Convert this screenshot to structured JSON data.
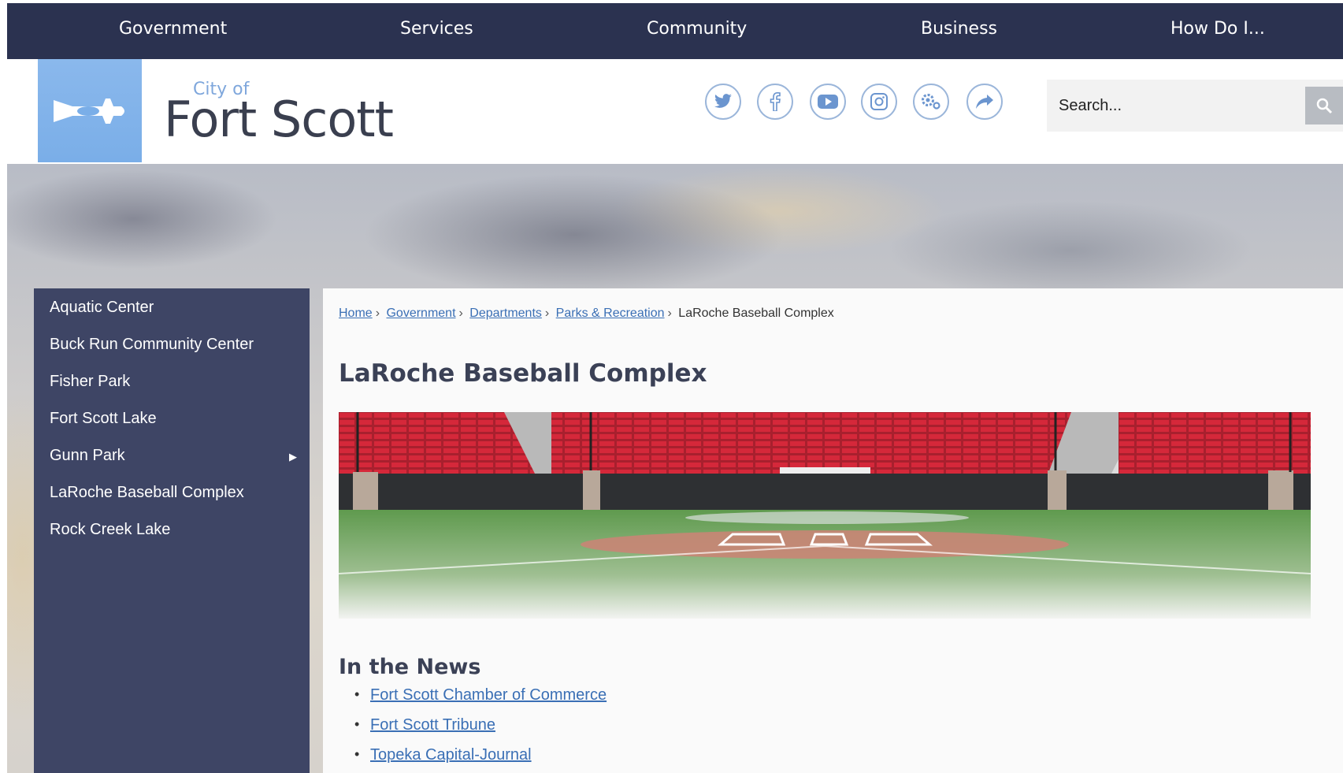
{
  "topnav": {
    "items": [
      "Government",
      "Services",
      "Community",
      "Business",
      "How Do I..."
    ]
  },
  "header": {
    "logo_city_of": "City of",
    "logo_name": "Fort Scott",
    "social_icons": [
      "twitter-icon",
      "facebook-icon",
      "youtube-icon",
      "instagram-icon",
      "settings-icon",
      "share-icon"
    ],
    "search": {
      "placeholder": "Search..."
    }
  },
  "sidebar": {
    "items": [
      {
        "label": "Aquatic Center"
      },
      {
        "label": "Buck Run Community Center"
      },
      {
        "label": "Fisher Park"
      },
      {
        "label": "Fort Scott Lake"
      },
      {
        "label": "Gunn Park",
        "has_submenu": true
      },
      {
        "label": "LaRoche Baseball Complex"
      },
      {
        "label": "Rock Creek Lake"
      }
    ],
    "submenu_arrow": "▶"
  },
  "breadcrumb": {
    "items": [
      "Home",
      "Government",
      "Departments",
      "Parks & Recreation"
    ],
    "current": "LaRoche Baseball Complex",
    "separator": "›"
  },
  "page": {
    "title": "LaRoche Baseball Complex"
  },
  "news": {
    "title": "In the News",
    "links": [
      "Fort Scott Chamber of Commerce",
      "Fort Scott Tribune",
      "Topeka Capital-Journal"
    ]
  },
  "colors": {
    "nav_bg": "#2b3250",
    "sidebar_bg": "#3e4565",
    "logo_blue": "#8ab8ec",
    "link_blue": "#3a6fb5",
    "seat_red": "#d5283a"
  }
}
